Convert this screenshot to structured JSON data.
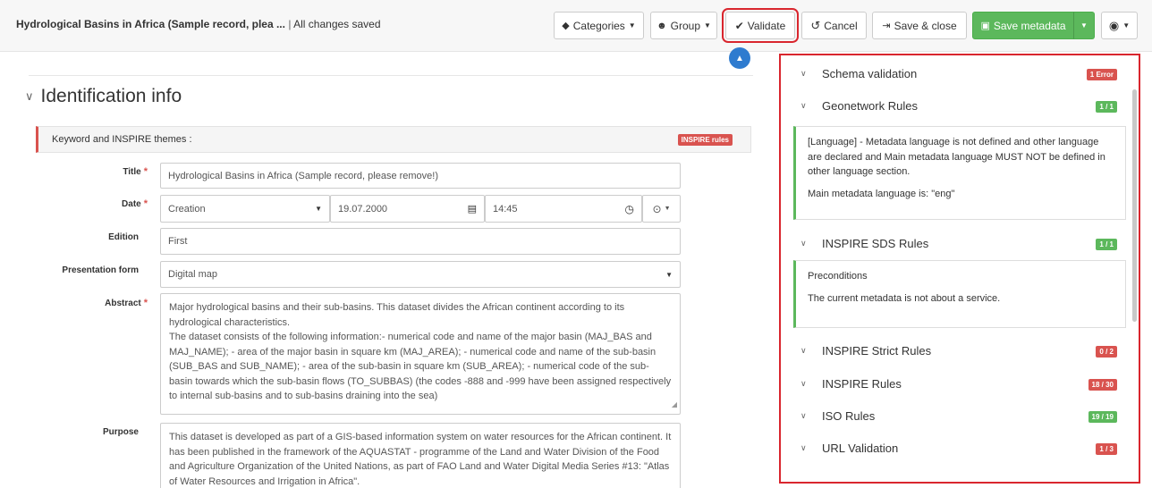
{
  "header": {
    "record_title": "Hydrological Basins in Africa (Sample record, plea ...",
    "separator": "|",
    "save_status": "All changes saved",
    "categories_label": "Categories",
    "group_label": "Group",
    "validate_label": "Validate",
    "cancel_label": "Cancel",
    "save_close_label": "Save & close",
    "save_metadata_label": "Save metadata"
  },
  "form": {
    "section_title": "Identification info",
    "keyword_row_label": "Keyword and INSPIRE themes :",
    "keyword_badge": "INSPIRE rules",
    "title_label": "Title",
    "title_value": "Hydrological Basins in Africa (Sample record, please remove!)",
    "date_label": "Date",
    "date_type": "Creation",
    "date_value": "19.07.2000",
    "time_value": "14:45",
    "edition_label": "Edition",
    "edition_value": "First",
    "presentation_label": "Presentation form",
    "presentation_value": "Digital map",
    "abstract_label": "Abstract",
    "abstract_p1": "Major hydrological basins and their sub-basins. This dataset divides the African continent according to its hydrological characteristics.",
    "abstract_p2": "The dataset consists of the following information:- numerical code and name of the major basin (MAJ_BAS and MAJ_NAME); - area of the major basin in square km (MAJ_AREA); - numerical code and name of the sub-basin (SUB_BAS and SUB_NAME); - area of the sub-basin in square km (SUB_AREA); - numerical code of the sub-basin towards which the sub-basin flows (TO_SUBBAS) (the codes -888 and -999 have been assigned respectively to internal sub-basins and to sub-basins draining into the sea)",
    "purpose_label": "Purpose",
    "purpose_value": "This dataset is developed as part of a GIS-based information system on water resources for the African continent. It has been published in the framework of the AQUASTAT - programme of the Land and Water Division of the Food and Agriculture Organization of the United Nations, as part of FAO Land and Water Digital Media Series #13: \"Atlas of Water Resources and Irrigation in Africa\"."
  },
  "validation": {
    "rules": [
      {
        "name": "Schema validation",
        "badge": "1 Error",
        "status": "error"
      },
      {
        "name": "Geonetwork Rules",
        "badge": "1 / 1",
        "status": "ok"
      },
      {
        "name": "INSPIRE SDS Rules",
        "badge": "1 / 1",
        "status": "ok"
      },
      {
        "name": "INSPIRE Strict Rules",
        "badge": "0 / 2",
        "status": "error"
      },
      {
        "name": "INSPIRE Rules",
        "badge": "18 / 30",
        "status": "error"
      },
      {
        "name": "ISO Rules",
        "badge": "19 / 19",
        "status": "ok"
      },
      {
        "name": "URL Validation",
        "badge": "1 / 3",
        "status": "error"
      }
    ],
    "geonetwork_msg1": "[Language] - Metadata language is not defined and other language are declared and Main metadata language MUST NOT be defined in other language section.",
    "geonetwork_msg2": "Main metadata language is: \"eng\"",
    "sds_msg1": "Preconditions",
    "sds_msg2": "The current metadata is not about a service."
  },
  "colors": {
    "accent_red": "#d9262e",
    "success_green": "#5cb85c",
    "error_badge": "#d9534f",
    "collapse_blue": "#2e7bcf"
  },
  "icons": {
    "categories": "tag-icon",
    "group": "users-icon",
    "validate": "check-icon",
    "cancel": "undo-icon",
    "save_close": "sign-out-icon",
    "save_metadata": "floppy-icon",
    "view": "eye-icon",
    "collapse": "chevron-up-icon"
  }
}
